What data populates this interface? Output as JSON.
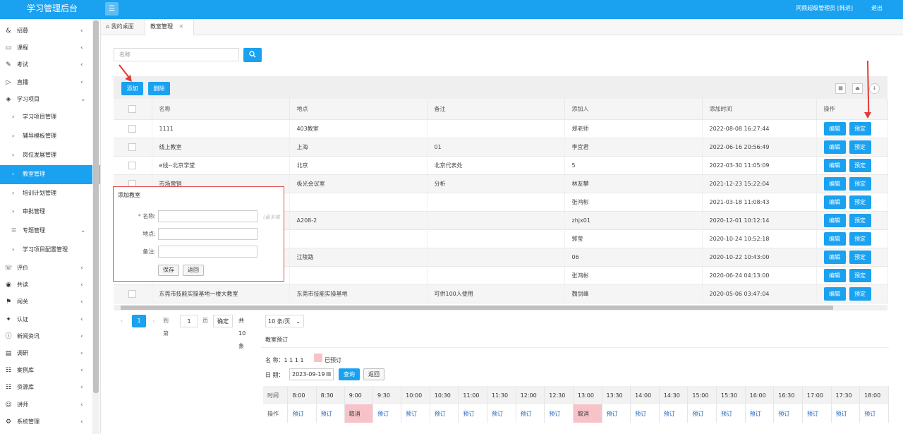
{
  "app": {
    "brand": "学习管理后台",
    "user_label": "同鼎超级管理员 [韩进]",
    "logout_label": "退出"
  },
  "sidebar": {
    "items": [
      {
        "label": "招募",
        "icon": "ampersand-icon"
      },
      {
        "label": "课程",
        "icon": "book-icon"
      },
      {
        "label": "考试",
        "icon": "edit-icon"
      },
      {
        "label": "直播",
        "icon": "video-icon"
      },
      {
        "label": "学习项目",
        "icon": "cube-icon"
      }
    ],
    "subitems": [
      {
        "label": "学习项目管理"
      },
      {
        "label": "辅导模板管理"
      },
      {
        "label": "岗位发展管理"
      },
      {
        "label": "教室管理"
      },
      {
        "label": "培训计划管理"
      },
      {
        "label": "审批管理"
      },
      {
        "label": "专题管理"
      },
      {
        "label": "学习项目配置管理"
      }
    ],
    "items2": [
      {
        "label": "评价",
        "icon": "comment-icon"
      },
      {
        "label": "共读",
        "icon": "eye-icon"
      },
      {
        "label": "闯关",
        "icon": "flag-icon"
      },
      {
        "label": "认证",
        "icon": "certificate-icon"
      },
      {
        "label": "新闻资讯",
        "icon": "info-icon"
      },
      {
        "label": "调研",
        "icon": "survey-icon"
      },
      {
        "label": "案例库",
        "icon": "database-icon"
      },
      {
        "label": "资源库",
        "icon": "database-icon"
      },
      {
        "label": "讲师",
        "icon": "teacher-icon"
      },
      {
        "label": "系统管理",
        "icon": "gear-icon"
      }
    ]
  },
  "tabs": {
    "home": "我的桌面",
    "current": "教室管理",
    "close": "✕"
  },
  "search": {
    "placeholder": "名称"
  },
  "toolbar": {
    "add": "添加",
    "delete": "删除"
  },
  "table": {
    "headers": [
      "名称",
      "地点",
      "备注",
      "添加人",
      "添加时间",
      "操作"
    ],
    "edit_label": "编辑",
    "book_label": "预定",
    "rows": [
      {
        "name": "1111",
        "place": "403教室",
        "note": "",
        "adder": "郑老师",
        "time": "2022-08-08 16:27:44"
      },
      {
        "name": "线上教室",
        "place": "上海",
        "note": "01",
        "adder": "李宜君",
        "time": "2022-06-16 20:56:49"
      },
      {
        "name": "e线--北京学堂",
        "place": "北京",
        "note": "北京代表处",
        "adder": "5",
        "time": "2022-03-30 11:05:09"
      },
      {
        "name": "市场营销",
        "place": "极光会议室",
        "note": "分析",
        "adder": "林友攀",
        "time": "2021-12-23 15:22:04"
      },
      {
        "name": "",
        "place": "",
        "note": "",
        "adder": "张鸿彬",
        "time": "2021-03-18 11:08:43"
      },
      {
        "name": "",
        "place": "A208-2",
        "note": "",
        "adder": "zhjx01",
        "time": "2020-12-01 10:12:14"
      },
      {
        "name": "",
        "place": "",
        "note": "",
        "adder": "郭莹",
        "time": "2020-10-24 10:52:18"
      },
      {
        "name": "",
        "place": "江陵路",
        "note": "",
        "adder": "06",
        "time": "2020-10-22 10:43:00"
      },
      {
        "name": "",
        "place": "",
        "note": "",
        "adder": "张鸿彬",
        "time": "2020-06-24 04:13:00"
      },
      {
        "name": "东莞市技能实操基地一楼大教室",
        "place": "东莞市技能实操基地",
        "note": "可供100人使用",
        "adder": "魏剑峰",
        "time": "2020-05-06 03:47:04"
      }
    ]
  },
  "pager": {
    "prev": "‹",
    "current": "1",
    "next": "›",
    "goto": "到第",
    "page_input": "1",
    "page_unit": "页",
    "confirm": "确定",
    "total": "共 10 条",
    "per_page": "10 条/页"
  },
  "dialog": {
    "title": "添加教室",
    "name_label": "名称:",
    "name_required": "*",
    "name_hint": "(最多输",
    "place_label": "地点:",
    "note_label": "备注:",
    "save": "保存",
    "back": "返回"
  },
  "booking": {
    "title": "教室预订",
    "name_label": "名 称：",
    "name_value": "1 1 1 1",
    "legend_booked": "已预订",
    "date_label": "日 期：",
    "date_value": "2023-09-19",
    "query": "查询",
    "back": "返回",
    "row_time_label": "时间",
    "row_action_label": "操作",
    "book_label": "预订",
    "cancel_label": "取消",
    "slots": [
      "8:00",
      "8:30",
      "9:00",
      "9:30",
      "10:00",
      "10:30",
      "11:00",
      "11:30",
      "12:00",
      "12:30",
      "13:00",
      "13:30",
      "14:00",
      "14:30",
      "15:00",
      "15:30",
      "16:00",
      "16:30",
      "17:00",
      "17:30",
      "18:00"
    ],
    "cancel_slots": [
      "9:00",
      "13:00"
    ],
    "booked_color": "#f7c3c8"
  },
  "colors": {
    "accent": "#1aa1f0",
    "annotation": "#e53935"
  }
}
